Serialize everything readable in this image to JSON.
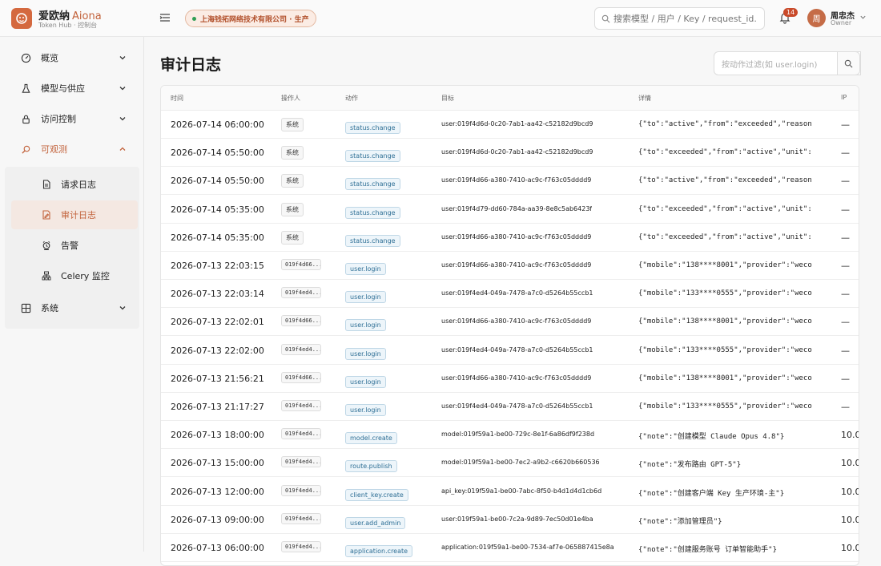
{
  "app": {
    "name": "爱欧纳",
    "name_en": "Aiona",
    "subtitle": "Token Hub · 控制台",
    "org": "上海钱拓网络技术有限公司 · 生产",
    "search_placeholder": "搜索模型 / 用户 / Key / request_id...",
    "notifications": "14",
    "user_initial": "周",
    "user_name": "周忠杰",
    "user_role": "Owner"
  },
  "sidebar": {
    "items": [
      {
        "label": "概览",
        "icon": "dashboard-icon"
      },
      {
        "label": "模型与供应",
        "icon": "flask-icon"
      },
      {
        "label": "访问控制",
        "icon": "lock-icon"
      },
      {
        "label": "可观测",
        "icon": "search-icon"
      },
      {
        "label": "系统",
        "icon": "grid-icon"
      }
    ],
    "sub_items": [
      {
        "label": "请求日志",
        "icon": "file-icon"
      },
      {
        "label": "审计日志",
        "icon": "edit-file-icon"
      },
      {
        "label": "告警",
        "icon": "alarm-icon"
      },
      {
        "label": "Celery 监控",
        "icon": "server-icon"
      }
    ]
  },
  "page": {
    "title": "审计日志",
    "filter_placeholder": "按动作过滤(如 user.login)"
  },
  "table": {
    "headers": [
      "时间",
      "操作人",
      "动作",
      "目标",
      "详情",
      "IP"
    ],
    "rows": [
      {
        "time": "2026-07-14 06:00:00",
        "actor": "系统",
        "actor_type": "system",
        "action": "status.change",
        "target": "user:019f4d6d-0c20-7ab1-aa42-c52182d9bcd9",
        "detail": "{\"to\":\"active\",\"from\":\"exceeded\",\"reason",
        "ip": "—"
      },
      {
        "time": "2026-07-14 05:50:00",
        "actor": "系统",
        "actor_type": "system",
        "action": "status.change",
        "target": "user:019f4d6d-0c20-7ab1-aa42-c52182d9bcd9",
        "detail": "{\"to\":\"exceeded\",\"from\":\"active\",\"unit\":",
        "ip": "—"
      },
      {
        "time": "2026-07-14 05:50:00",
        "actor": "系统",
        "actor_type": "system",
        "action": "status.change",
        "target": "user:019f4d66-a380-7410-ac9c-f763c05dddd9",
        "detail": "{\"to\":\"active\",\"from\":\"exceeded\",\"reason",
        "ip": "—"
      },
      {
        "time": "2026-07-14 05:35:00",
        "actor": "系统",
        "actor_type": "system",
        "action": "status.change",
        "target": "user:019f4d79-dd60-784a-aa39-8e8c5ab6423f",
        "detail": "{\"to\":\"exceeded\",\"from\":\"active\",\"unit\":",
        "ip": "—"
      },
      {
        "time": "2026-07-14 05:35:00",
        "actor": "系统",
        "actor_type": "system",
        "action": "status.change",
        "target": "user:019f4d66-a380-7410-ac9c-f763c05dddd9",
        "detail": "{\"to\":\"exceeded\",\"from\":\"active\",\"unit\":",
        "ip": "—"
      },
      {
        "time": "2026-07-13 22:03:15",
        "actor": "019f4d66...",
        "actor_type": "id",
        "action": "user.login",
        "target": "user:019f4d66-a380-7410-ac9c-f763c05dddd9",
        "detail": "{\"mobile\":\"138****8001\",\"provider\":\"weco",
        "ip": "—"
      },
      {
        "time": "2026-07-13 22:03:14",
        "actor": "019f4ed4...",
        "actor_type": "id",
        "action": "user.login",
        "target": "user:019f4ed4-049a-7478-a7c0-d5264b55ccb1",
        "detail": "{\"mobile\":\"133****0555\",\"provider\":\"weco",
        "ip": "—"
      },
      {
        "time": "2026-07-13 22:02:01",
        "actor": "019f4d66...",
        "actor_type": "id",
        "action": "user.login",
        "target": "user:019f4d66-a380-7410-ac9c-f763c05dddd9",
        "detail": "{\"mobile\":\"138****8001\",\"provider\":\"weco",
        "ip": "—"
      },
      {
        "time": "2026-07-13 22:02:00",
        "actor": "019f4ed4...",
        "actor_type": "id",
        "action": "user.login",
        "target": "user:019f4ed4-049a-7478-a7c0-d5264b55ccb1",
        "detail": "{\"mobile\":\"133****0555\",\"provider\":\"weco",
        "ip": "—"
      },
      {
        "time": "2026-07-13 21:56:21",
        "actor": "019f4d66...",
        "actor_type": "id",
        "action": "user.login",
        "target": "user:019f4d66-a380-7410-ac9c-f763c05dddd9",
        "detail": "{\"mobile\":\"138****8001\",\"provider\":\"weco",
        "ip": "—"
      },
      {
        "time": "2026-07-13 21:17:27",
        "actor": "019f4ed4...",
        "actor_type": "id",
        "action": "user.login",
        "target": "user:019f4ed4-049a-7478-a7c0-d5264b55ccb1",
        "detail": "{\"mobile\":\"133****0555\",\"provider\":\"weco",
        "ip": "—"
      },
      {
        "time": "2026-07-13 18:00:00",
        "actor": "019f4ed4...",
        "actor_type": "id",
        "action": "model.create",
        "target": "model:019f59a1-be00-729c-8e1f-6a86df9f238d",
        "detail": "{\"note\":\"创建模型 Claude Opus 4.8\"}",
        "ip": "10.0."
      },
      {
        "time": "2026-07-13 15:00:00",
        "actor": "019f4ed4...",
        "actor_type": "id",
        "action": "route.publish",
        "target": "model:019f59a1-be00-7ec2-a9b2-c6620b660536",
        "detail": "{\"note\":\"发布路由 GPT-5\"}",
        "ip": "10.0."
      },
      {
        "time": "2026-07-13 12:00:00",
        "actor": "019f4ed4...",
        "actor_type": "id",
        "action": "client_key.create",
        "target": "api_key:019f59a1-be00-7abc-8f50-b4d1d4d1cb6d",
        "detail": "{\"note\":\"创建客户端 Key 生产环境-主\"}",
        "ip": "10.0."
      },
      {
        "time": "2026-07-13 09:00:00",
        "actor": "019f4ed4...",
        "actor_type": "id",
        "action": "user.add_admin",
        "target": "user:019f59a1-be00-7c2a-9d89-7ec50d01e4ba",
        "detail": "{\"note\":\"添加管理员\"}",
        "ip": "10.0."
      },
      {
        "time": "2026-07-13 06:00:00",
        "actor": "019f4ed4...",
        "actor_type": "id",
        "action": "application.create",
        "target": "application:019f59a1-be00-7534-af7e-065887415e8a",
        "detail": "{\"note\":\"创建服务账号 订单智能助手\"}",
        "ip": "10.0."
      }
    ]
  }
}
